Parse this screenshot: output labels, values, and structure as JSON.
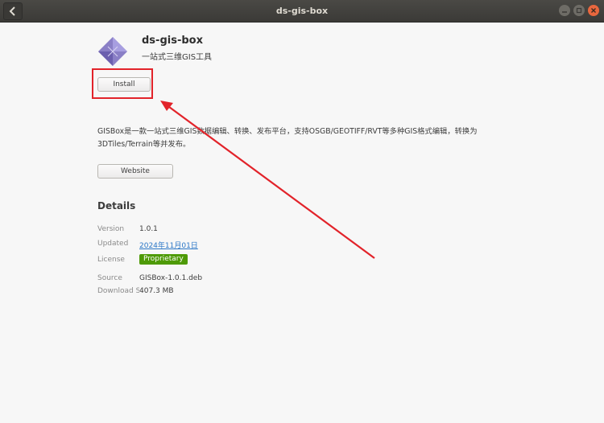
{
  "window": {
    "title": "ds-gis-box"
  },
  "app": {
    "name": "ds-gis-box",
    "summary": "一站式三维GIS工具",
    "install_label": "Install",
    "description": "GISBox是一款一站式三维GIS数据编辑、转换、发布平台，支持OSGB/GEOTIFF/RVT等多种GIS格式编辑，转换为3DTiles/Terrain等并发布。",
    "website_label": "Website"
  },
  "details": {
    "heading": "Details",
    "version": {
      "label": "Version",
      "value": "1.0.1"
    },
    "updated": {
      "label": "Updated",
      "value": "2024年11月01日"
    },
    "license": {
      "label": "License",
      "value": "Proprietary"
    },
    "source": {
      "label": "Source",
      "value": "GISBox-1.0.1.deb"
    },
    "download_size": {
      "label": "Download Size",
      "value": "407.3 MB"
    }
  },
  "colors": {
    "annotation": "#e2232a",
    "license_badge": "#4e9a06",
    "link": "#2a76c6"
  }
}
